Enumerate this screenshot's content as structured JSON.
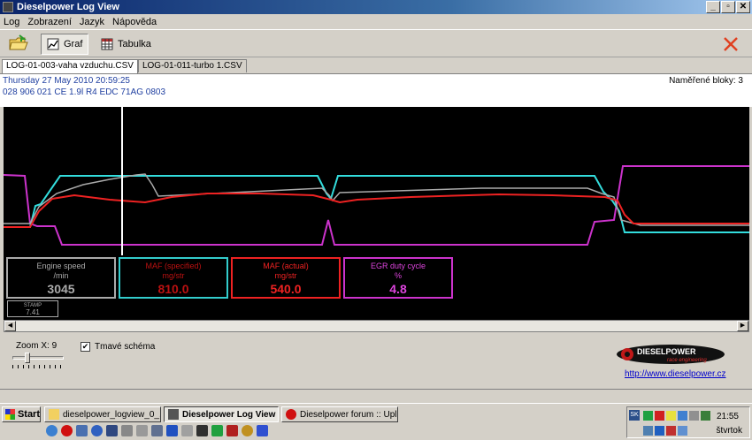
{
  "window": {
    "title": "Dieselpower Log View",
    "buttons": [
      "_",
      "▫",
      "✕"
    ]
  },
  "menu": {
    "items": [
      "Log",
      "Zobrazení",
      "Jazyk",
      "Nápověda"
    ]
  },
  "toolbar": {
    "graph_label": "Graf",
    "table_label": "Tabulka"
  },
  "tabs": [
    "LOG-01-003-vaha vzduchu.CSV",
    "LOG-01-011-turbo 1.CSV"
  ],
  "info": {
    "date": "Thursday 27 May 2010 20:59:25",
    "ecu": "028 906 021 CE  1.9l R4 EDC   71AG  0803",
    "blocks": "Naměřené bloky: 3"
  },
  "chart_data": {
    "type": "line",
    "title": "",
    "xlabel": "",
    "ylabel": "",
    "grid": false,
    "cursor_x": 0.16,
    "series": [
      {
        "name": "Engine speed",
        "color": "#aaaaaa"
      },
      {
        "name": "MAF (specified)",
        "color": "#33dddd"
      },
      {
        "name": "MAF (actual)",
        "color": "#ee2222"
      },
      {
        "name": "EGR duty cycle",
        "color": "#cc33cc"
      }
    ]
  },
  "readouts": [
    {
      "name": "Engine speed",
      "unit": "/min",
      "value": "3045",
      "color": "#aaaaaa"
    },
    {
      "name": "MAF (specified)",
      "unit": "mg/str",
      "value": "810.0",
      "color": "#33cccc"
    },
    {
      "name": "MAF (actual)",
      "unit": "mg/str",
      "value": "540.0",
      "color": "#ee2222"
    },
    {
      "name": "EGR duty cycle",
      "unit": "%",
      "value": "4.8",
      "color": "#cc33cc"
    }
  ],
  "stamp": {
    "label": "STAMP",
    "value": "7.41"
  },
  "zoom": {
    "label": "Zoom X: 9"
  },
  "dark_scheme": {
    "label": "Tmavé schéma",
    "checked": true
  },
  "logo": {
    "name": "DIESELPOWER",
    "tagline": "race engineering"
  },
  "link": "http://www.dieselpower.cz",
  "taskbar": {
    "start": "Start",
    "tasks": [
      "dieselpower_logview_0_...",
      "Dieselpower Log View",
      "Dieselpower forum :: Upl..."
    ],
    "tray_sk": "SK",
    "time": "21:55",
    "day": "štvrtok"
  }
}
